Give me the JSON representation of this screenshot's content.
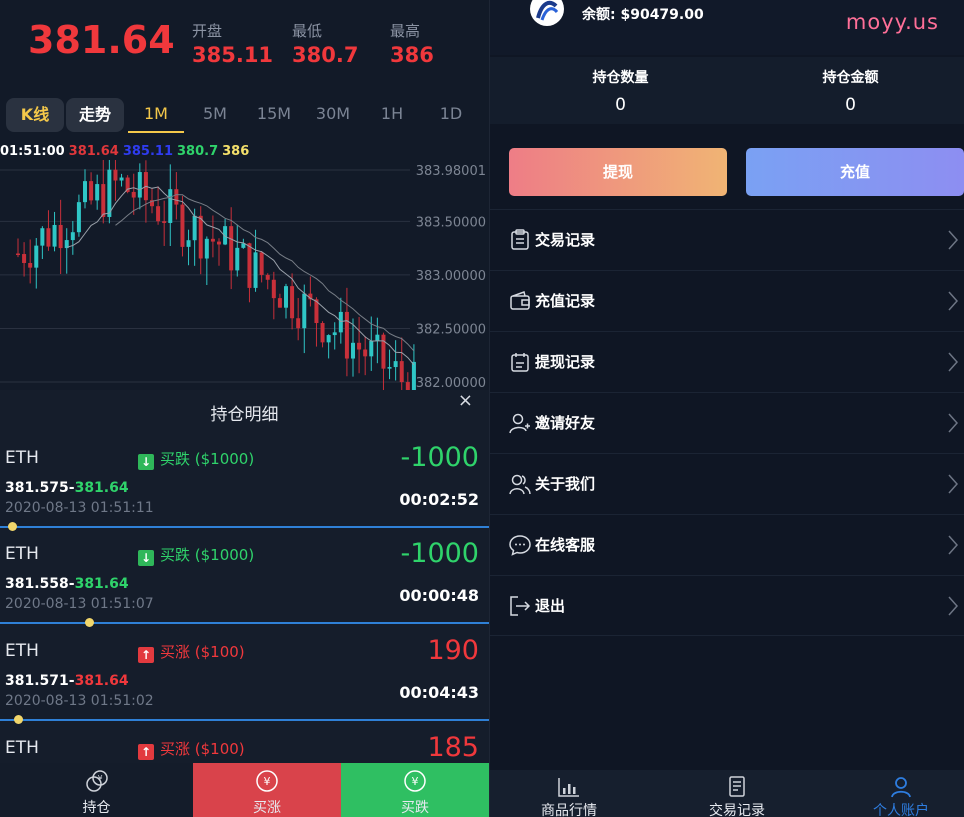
{
  "quote": {
    "price": "381.64",
    "open_label": "开盘",
    "open": "385.11",
    "low_label": "最低",
    "low": "380.7",
    "high_label": "最高",
    "high": "386"
  },
  "tabs": [
    "K线",
    "走势",
    "1M",
    "5M",
    "15M",
    "30M",
    "1H",
    "1D"
  ],
  "active_tab": "1M",
  "legend": {
    "time": "01:51:00",
    "v1": "381.64",
    "v2": "385.11",
    "v3": "380.7",
    "v4": "386",
    "colors": {
      "time": "#ffffff",
      "v1": "#e0373b",
      "v2": "#2f3cf0",
      "v3": "#2fd36b",
      "v4": "#f4e06b"
    }
  },
  "chart_data": {
    "type": "candlestick",
    "y_ticks": [
      "383.98001",
      "383.50000",
      "383.00000",
      "382.50000",
      "382.00000"
    ],
    "ylim": [
      382.0,
      383.98001
    ],
    "colors": {
      "up": "#2fc6c6",
      "down": "#c8303a",
      "ma1": "#9aa1aa",
      "ma2": "#777d86"
    }
  },
  "positions": {
    "title": "持仓明细",
    "close": "×",
    "orders": [
      {
        "symbol": "ETH",
        "direction": "买跌 ($1000)",
        "side": "down",
        "pnl": "-1000",
        "open_price": "381.575",
        "close_price": "381.64",
        "time": "2020-08-13 01:51:11",
        "duration": "00:02:52"
      },
      {
        "symbol": "ETH",
        "direction": "买跌 ($1000)",
        "side": "down",
        "pnl": "-1000",
        "open_price": "381.558",
        "close_price": "381.64",
        "time": "2020-08-13 01:51:07",
        "duration": "00:00:48"
      },
      {
        "symbol": "ETH",
        "direction": "买涨 ($100)",
        "side": "up",
        "pnl": "190",
        "open_price": "381.571",
        "close_price": "381.64",
        "time": "2020-08-13 01:51:02",
        "duration": "00:04:43"
      },
      {
        "symbol": "ETH",
        "direction": "买涨 ($100)",
        "side": "up",
        "pnl": "185",
        "open_price": "",
        "close_price": "",
        "time": "",
        "duration": ""
      }
    ]
  },
  "left_footer": {
    "hold": "持仓",
    "buy_up": "买涨",
    "buy_down": "买跌"
  },
  "account": {
    "balance": "余额: $90479.00",
    "watermark": "moyy.us",
    "hold_qty_label": "持仓数量",
    "hold_qty": "0",
    "hold_amt_label": "持仓金额",
    "hold_amt": "0",
    "withdraw": "提现",
    "deposit": "充值"
  },
  "menu": [
    "交易记录",
    "充值记录",
    "提现记录",
    "邀请好友",
    "关于我们",
    "在线客服",
    "退出"
  ],
  "right_footer": {
    "market": "商品行情",
    "trades": "交易记录",
    "account": "个人账户"
  }
}
